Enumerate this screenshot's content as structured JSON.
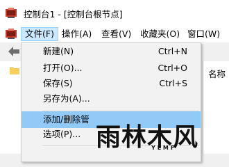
{
  "window": {
    "title": "控制台1 - [控制台根节点]"
  },
  "menubar": {
    "items": [
      {
        "label": "文件(F)",
        "active": true
      },
      {
        "label": "操作(A)"
      },
      {
        "label": "查看(V)"
      },
      {
        "label": "收藏夹(O)"
      },
      {
        "label": "窗口(W)"
      }
    ]
  },
  "file_menu": {
    "items": [
      {
        "label": "新建(N)",
        "shortcut": "Ctrl+N"
      },
      {
        "label": "打开(O)...",
        "shortcut": "Ctrl+O"
      },
      {
        "label": "保存(S)",
        "shortcut": "Ctrl+S"
      },
      {
        "label": "另存为(A)...",
        "shortcut": ""
      },
      {
        "label": "添加/删除管",
        "shortcut": "",
        "highlighted": true
      },
      {
        "label": "选项(P)...",
        "shortcut": ""
      }
    ]
  },
  "right_pane": {
    "header": "名称"
  },
  "watermark": {
    "text": "雨林木风",
    "sub": "YLMF"
  },
  "colors": {
    "highlight": "#91c9f7",
    "menu_active": "#cce8ff"
  }
}
